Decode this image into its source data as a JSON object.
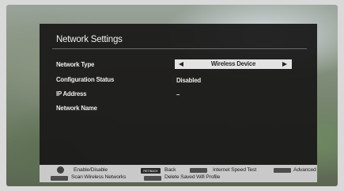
{
  "panel": {
    "title": "Network Settings",
    "rows": [
      {
        "label": "Network Type",
        "value": "Wireless Device"
      },
      {
        "label": "Configuration Status",
        "value": "Disabled"
      },
      {
        "label": "IP Address",
        "value": "–"
      },
      {
        "label": "Network Name",
        "value": ""
      }
    ]
  },
  "footer": {
    "enable_disable": "Enable/Disable",
    "ret_back_key": "RET/BACK",
    "back": "Back",
    "internet_speed_test": "Internet Speed Test",
    "advanced": "Advanced",
    "scan_wireless_networks": "Scan Wireless Networks",
    "delete_saved_wifi_profile": "Delete Saved Wifi Profile"
  },
  "colors": {
    "panel_bg": "#1a1818",
    "selector_bg": "#e3e3e3",
    "footer_bg": "#c9c9c9"
  },
  "icons": {
    "selector_left": "left-triangle-icon",
    "selector_right": "right-triangle-icon"
  }
}
